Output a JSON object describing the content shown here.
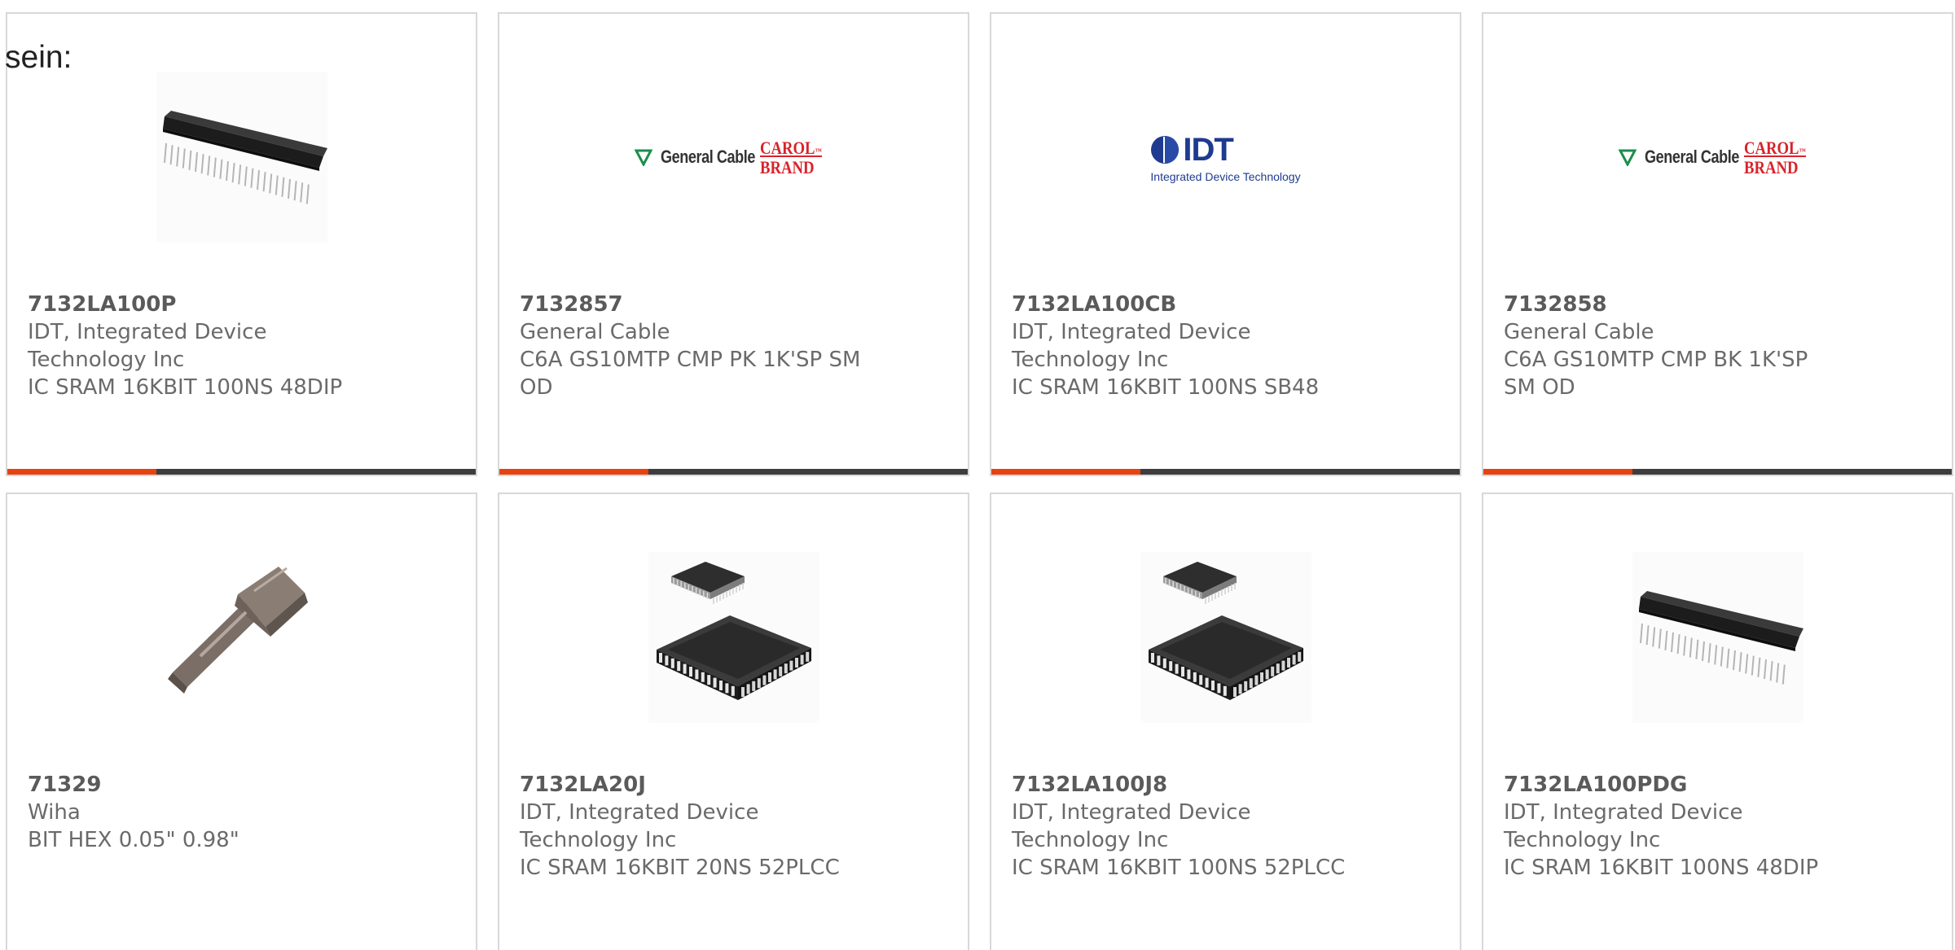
{
  "intro_text": "sein:",
  "colors": {
    "accent": "#e8420f",
    "bar": "#3d3d3d",
    "text": "#6a6a6a",
    "border": "#d8d8d8"
  },
  "products": [
    {
      "part_number": "7132LA100P",
      "manufacturer": "IDT, Integrated Device Technology Inc",
      "description": "IC SRAM 16KBIT 100NS 48DIP",
      "image": "dip-chip-image",
      "show_bar": true
    },
    {
      "part_number": "7132857",
      "manufacturer": "General Cable",
      "description": "C6A GS10MTP CMP PK 1K'SP SM OD",
      "image": "general-cable-logo",
      "logo": {
        "name": "General Cable",
        "brand_line1": "CAROL",
        "brand_line2": "BRAND"
      },
      "show_bar": true
    },
    {
      "part_number": "7132LA100CB",
      "manufacturer": "IDT, Integrated Device Technology Inc",
      "description": "IC SRAM 16KBIT 100NS SB48",
      "image": "idt-logo",
      "logo": {
        "name": "IDT",
        "tagline": "Integrated Device Technology"
      },
      "show_bar": true
    },
    {
      "part_number": "7132858",
      "manufacturer": "General Cable",
      "description": "C6A GS10MTP CMP BK 1K'SP SM OD",
      "image": "general-cable-logo",
      "logo": {
        "name": "General Cable",
        "brand_line1": "CAROL",
        "brand_line2": "BRAND"
      },
      "show_bar": true
    },
    {
      "part_number": "71329",
      "manufacturer": "Wiha",
      "description": "BIT HEX 0.05\" 0.98\"",
      "image": "hex-bit-image",
      "show_bar": false
    },
    {
      "part_number": "7132LA20J",
      "manufacturer": "IDT, Integrated Device Technology Inc",
      "description": "IC SRAM 16KBIT 20NS 52PLCC",
      "image": "plcc-chip-image",
      "show_bar": false
    },
    {
      "part_number": "7132LA100J8",
      "manufacturer": "IDT, Integrated Device Technology Inc",
      "description": "IC SRAM 16KBIT 100NS 52PLCC",
      "image": "plcc-chip-image",
      "show_bar": false
    },
    {
      "part_number": "7132LA100PDG",
      "manufacturer": "IDT, Integrated Device Technology Inc",
      "description": "IC SRAM 16KBIT 100NS 48DIP",
      "image": "dip-chip-image",
      "show_bar": false
    }
  ]
}
